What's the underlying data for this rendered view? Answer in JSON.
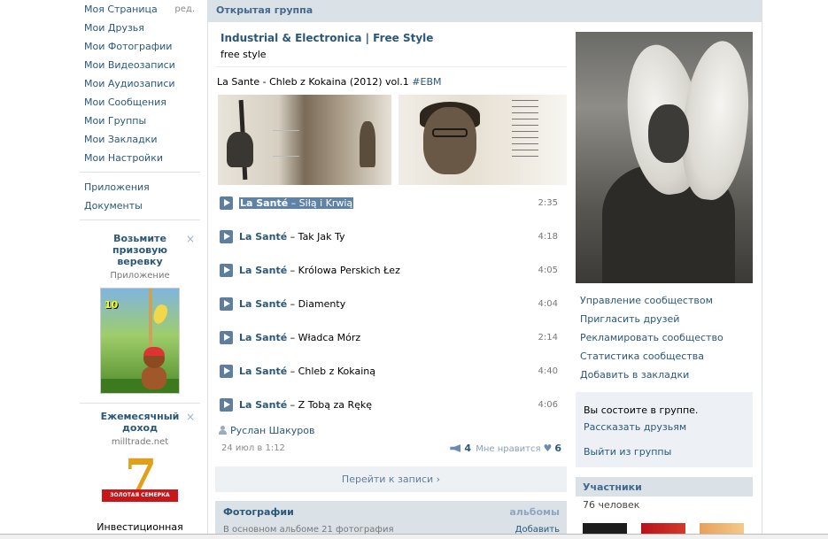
{
  "left_menu": {
    "items": [
      {
        "label": "Моя Страница",
        "extra": "ред."
      },
      {
        "label": "Мои Друзья"
      },
      {
        "label": "Мои Фотографии"
      },
      {
        "label": "Мои Видеозаписи"
      },
      {
        "label": "Мои Аудиозаписи"
      },
      {
        "label": "Мои Сообщения"
      },
      {
        "label": "Мои Группы"
      },
      {
        "label": "Мои Закладки"
      },
      {
        "label": "Мои Настройки"
      }
    ],
    "extra_items": [
      {
        "label": "Приложения"
      },
      {
        "label": "Документы"
      }
    ]
  },
  "promos": [
    {
      "title": "Возьмите призовую веревку",
      "subtitle": "Приложение",
      "close": "×",
      "game_counter": "10"
    },
    {
      "title": "Ежемесячный доход",
      "subtitle": "milltrade.net",
      "close": "×",
      "desc": "Инвестиционная программа «Золотая",
      "logo_digit": "7",
      "logo_text": "ЗОЛОТАЯ СЕМЕРКА"
    }
  ],
  "header": {
    "title": "Открытая группа"
  },
  "group": {
    "name": "Industrial & Electronica | Free Style",
    "status": "free style"
  },
  "post": {
    "text": "La Sante - Chleb z Kokaina (2012) vol.1",
    "tag": "#EBM",
    "tracks": [
      {
        "artist": "La Santé",
        "title": " – Siłą i Krwią",
        "duration": "2:35",
        "highlighted": true
      },
      {
        "artist": "La Santé",
        "title": " – Tak Jak Ty",
        "duration": "4:18"
      },
      {
        "artist": "La Santé",
        "title": " – Królowa Perskich Łez",
        "duration": "4:05"
      },
      {
        "artist": "La Santé",
        "title": " – Diamenty",
        "duration": "4:04"
      },
      {
        "artist": "La Santé",
        "title": " – Władca Mórz",
        "duration": "2:14"
      },
      {
        "artist": "La Santé",
        "title": " – Chleb z Kokainą",
        "duration": "4:40"
      },
      {
        "artist": "La Santé",
        "title": " – Z Tobą za Rękę",
        "duration": "4:06"
      }
    ],
    "author": "Руслан Шакуров",
    "date": "24 июл в 1:12",
    "share_count": "4",
    "like_label": "Мне нравится",
    "like_count": "6",
    "goto_label": "Перейти к записи ›"
  },
  "photos_block": {
    "title": "Фотографии",
    "albums": "альбомы",
    "sub": "В основном альбоме 21 фотография",
    "add": "Добавить"
  },
  "admin_links": [
    {
      "label": "Управление сообществом"
    },
    {
      "label": "Пригласить друзей"
    },
    {
      "label": "Рекламировать сообщество"
    },
    {
      "label": "Статистика сообщества"
    },
    {
      "label": "Добавить в закладки"
    }
  ],
  "membership": {
    "status": "Вы состоите в группе.",
    "tell": "Рассказать друзьям",
    "leave": "Выйти из группы"
  },
  "members": {
    "title": "Участники",
    "count": "76 человек"
  }
}
